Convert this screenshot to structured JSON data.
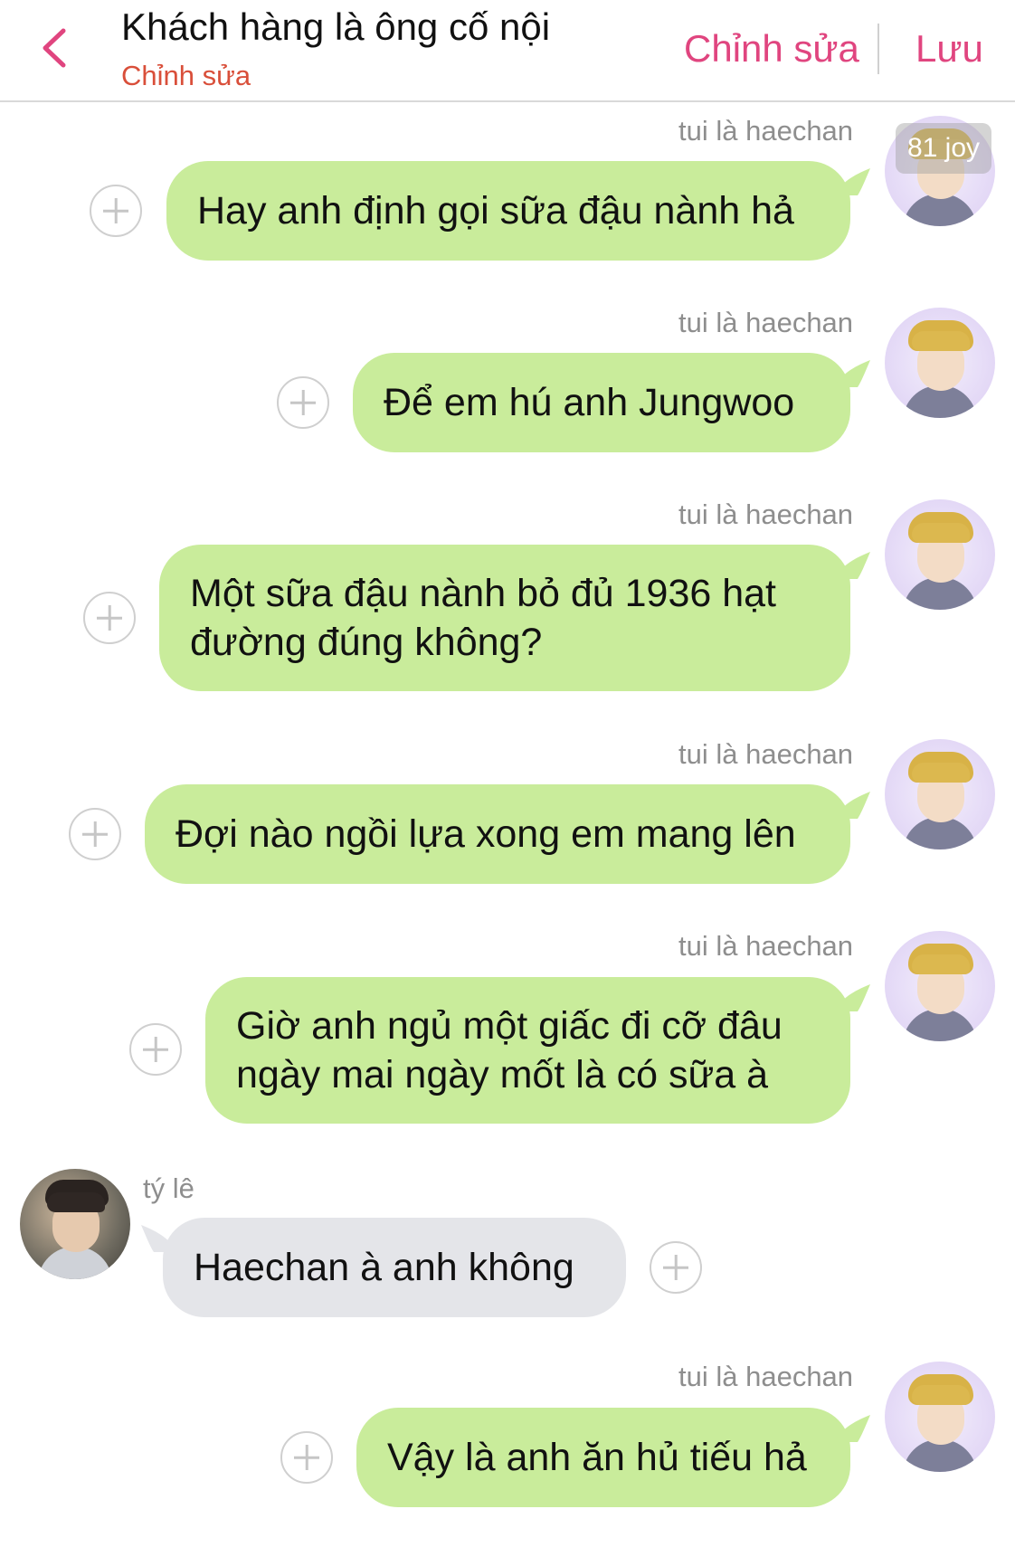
{
  "header": {
    "back_icon": "chevron-left-icon",
    "title": "Khách hàng là ông cố nội",
    "subtitle": "Chỉnh sửa",
    "edit_label": "Chỉnh sửa",
    "save_label": "Lưu",
    "accent_color": "#e0457f",
    "subtitle_color": "#d94f3a"
  },
  "chat": {
    "me_bubble_color": "#c9ec9b",
    "other_bubble_color": "#e4e5e9",
    "messages": [
      {
        "sender": "tui là haechan",
        "text": "Hay anh định gọi sữa đậu nành hả"
      },
      {
        "sender": "tui là haechan",
        "text": "Để em hú anh Jungwoo"
      },
      {
        "sender": "tui là haechan",
        "text": "Một sữa đậu nành bỏ đủ 1936 hạt\nđường đúng không?"
      },
      {
        "sender": "tui là haechan",
        "text": "Đợi nào ngồi lựa xong em mang lên"
      },
      {
        "sender": "tui là haechan",
        "text": "Giờ anh ngủ một giấc đi cỡ đâu\nngày mai ngày mốt là có sữa à"
      },
      {
        "sender": "tý lê",
        "text": "Haechan à anh không"
      },
      {
        "sender": "tui là haechan",
        "text": "Vậy là anh ăn hủ tiếu hả"
      }
    ]
  },
  "watermark": "81 joy"
}
